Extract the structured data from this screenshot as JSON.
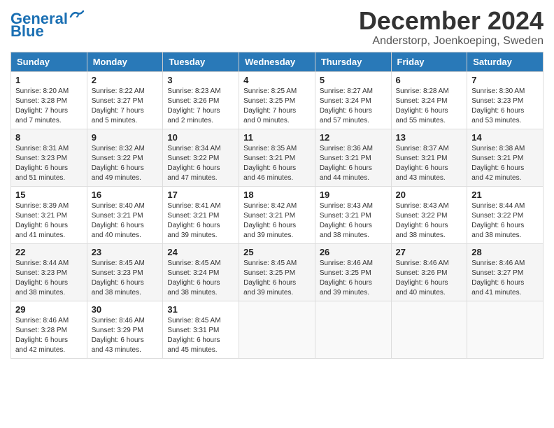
{
  "logo": {
    "line1": "General",
    "line2": "Blue"
  },
  "title": "December 2024",
  "subtitle": "Anderstorp, Joenkoeping, Sweden",
  "headers": [
    "Sunday",
    "Monday",
    "Tuesday",
    "Wednesday",
    "Thursday",
    "Friday",
    "Saturday"
  ],
  "weeks": [
    [
      {
        "day": "1",
        "info": "Sunrise: 8:20 AM\nSunset: 3:28 PM\nDaylight: 7 hours\nand 7 minutes."
      },
      {
        "day": "2",
        "info": "Sunrise: 8:22 AM\nSunset: 3:27 PM\nDaylight: 7 hours\nand 5 minutes."
      },
      {
        "day": "3",
        "info": "Sunrise: 8:23 AM\nSunset: 3:26 PM\nDaylight: 7 hours\nand 2 minutes."
      },
      {
        "day": "4",
        "info": "Sunrise: 8:25 AM\nSunset: 3:25 PM\nDaylight: 7 hours\nand 0 minutes."
      },
      {
        "day": "5",
        "info": "Sunrise: 8:27 AM\nSunset: 3:24 PM\nDaylight: 6 hours\nand 57 minutes."
      },
      {
        "day": "6",
        "info": "Sunrise: 8:28 AM\nSunset: 3:24 PM\nDaylight: 6 hours\nand 55 minutes."
      },
      {
        "day": "7",
        "info": "Sunrise: 8:30 AM\nSunset: 3:23 PM\nDaylight: 6 hours\nand 53 minutes."
      }
    ],
    [
      {
        "day": "8",
        "info": "Sunrise: 8:31 AM\nSunset: 3:23 PM\nDaylight: 6 hours\nand 51 minutes."
      },
      {
        "day": "9",
        "info": "Sunrise: 8:32 AM\nSunset: 3:22 PM\nDaylight: 6 hours\nand 49 minutes."
      },
      {
        "day": "10",
        "info": "Sunrise: 8:34 AM\nSunset: 3:22 PM\nDaylight: 6 hours\nand 47 minutes."
      },
      {
        "day": "11",
        "info": "Sunrise: 8:35 AM\nSunset: 3:21 PM\nDaylight: 6 hours\nand 46 minutes."
      },
      {
        "day": "12",
        "info": "Sunrise: 8:36 AM\nSunset: 3:21 PM\nDaylight: 6 hours\nand 44 minutes."
      },
      {
        "day": "13",
        "info": "Sunrise: 8:37 AM\nSunset: 3:21 PM\nDaylight: 6 hours\nand 43 minutes."
      },
      {
        "day": "14",
        "info": "Sunrise: 8:38 AM\nSunset: 3:21 PM\nDaylight: 6 hours\nand 42 minutes."
      }
    ],
    [
      {
        "day": "15",
        "info": "Sunrise: 8:39 AM\nSunset: 3:21 PM\nDaylight: 6 hours\nand 41 minutes."
      },
      {
        "day": "16",
        "info": "Sunrise: 8:40 AM\nSunset: 3:21 PM\nDaylight: 6 hours\nand 40 minutes."
      },
      {
        "day": "17",
        "info": "Sunrise: 8:41 AM\nSunset: 3:21 PM\nDaylight: 6 hours\nand 39 minutes."
      },
      {
        "day": "18",
        "info": "Sunrise: 8:42 AM\nSunset: 3:21 PM\nDaylight: 6 hours\nand 39 minutes."
      },
      {
        "day": "19",
        "info": "Sunrise: 8:43 AM\nSunset: 3:21 PM\nDaylight: 6 hours\nand 38 minutes."
      },
      {
        "day": "20",
        "info": "Sunrise: 8:43 AM\nSunset: 3:22 PM\nDaylight: 6 hours\nand 38 minutes."
      },
      {
        "day": "21",
        "info": "Sunrise: 8:44 AM\nSunset: 3:22 PM\nDaylight: 6 hours\nand 38 minutes."
      }
    ],
    [
      {
        "day": "22",
        "info": "Sunrise: 8:44 AM\nSunset: 3:23 PM\nDaylight: 6 hours\nand 38 minutes."
      },
      {
        "day": "23",
        "info": "Sunrise: 8:45 AM\nSunset: 3:23 PM\nDaylight: 6 hours\nand 38 minutes."
      },
      {
        "day": "24",
        "info": "Sunrise: 8:45 AM\nSunset: 3:24 PM\nDaylight: 6 hours\nand 38 minutes."
      },
      {
        "day": "25",
        "info": "Sunrise: 8:45 AM\nSunset: 3:25 PM\nDaylight: 6 hours\nand 39 minutes."
      },
      {
        "day": "26",
        "info": "Sunrise: 8:46 AM\nSunset: 3:25 PM\nDaylight: 6 hours\nand 39 minutes."
      },
      {
        "day": "27",
        "info": "Sunrise: 8:46 AM\nSunset: 3:26 PM\nDaylight: 6 hours\nand 40 minutes."
      },
      {
        "day": "28",
        "info": "Sunrise: 8:46 AM\nSunset: 3:27 PM\nDaylight: 6 hours\nand 41 minutes."
      }
    ],
    [
      {
        "day": "29",
        "info": "Sunrise: 8:46 AM\nSunset: 3:28 PM\nDaylight: 6 hours\nand 42 minutes."
      },
      {
        "day": "30",
        "info": "Sunrise: 8:46 AM\nSunset: 3:29 PM\nDaylight: 6 hours\nand 43 minutes."
      },
      {
        "day": "31",
        "info": "Sunrise: 8:45 AM\nSunset: 3:31 PM\nDaylight: 6 hours\nand 45 minutes."
      },
      null,
      null,
      null,
      null
    ]
  ]
}
